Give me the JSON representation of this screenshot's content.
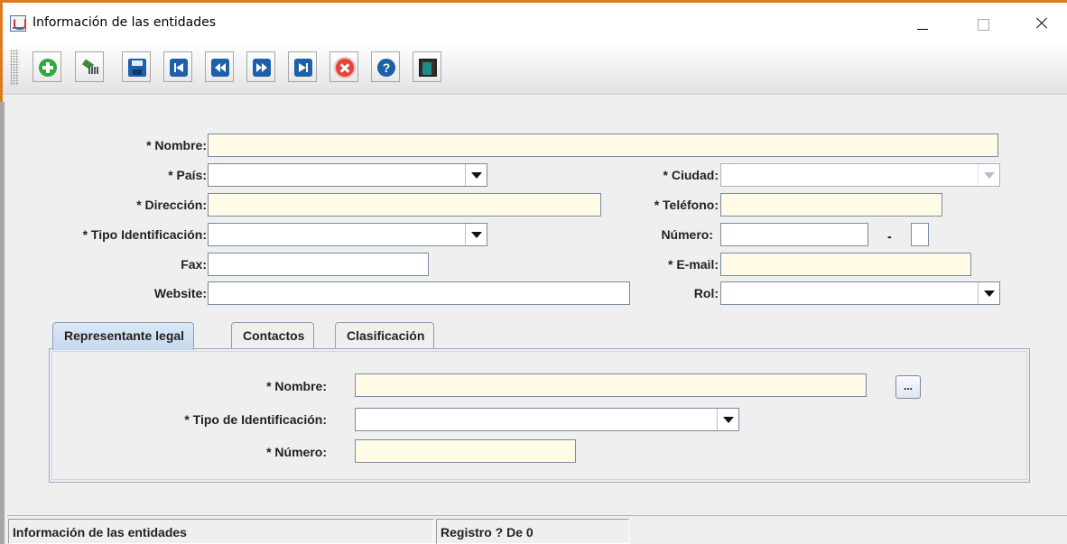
{
  "window": {
    "title": "Información de las entidades"
  },
  "toolbar": {
    "buttons": [
      {
        "name": "add-button",
        "icon": "plus-circle-icon"
      },
      {
        "name": "clear-button",
        "icon": "broom-icon"
      },
      {
        "name": "save-button",
        "icon": "floppy-disk-icon"
      },
      {
        "name": "first-record-button",
        "icon": "skip-first-icon"
      },
      {
        "name": "previous-record-button",
        "icon": "rewind-icon"
      },
      {
        "name": "next-record-button",
        "icon": "fast-forward-icon"
      },
      {
        "name": "last-record-button",
        "icon": "skip-last-icon"
      },
      {
        "name": "cancel-button",
        "icon": "close-circle-icon"
      },
      {
        "name": "help-button",
        "icon": "question-icon"
      },
      {
        "name": "exit-button",
        "icon": "exit-door-icon"
      }
    ]
  },
  "form": {
    "nombre_label": "* Nombre:",
    "nombre_value": "",
    "pais_label": "* País:",
    "pais_value": "",
    "ciudad_label": "* Ciudad:",
    "ciudad_value": "",
    "direccion_label": "* Dirección:",
    "direccion_value": "",
    "telefono_label": "* Teléfono:",
    "telefono_value": "",
    "tipo_id_label": "* Tipo Identificación:",
    "tipo_id_value": "",
    "numero_label": "Número:",
    "numero_value": "",
    "numero_separator": "-",
    "numero_dv_value": "",
    "fax_label": "Fax:",
    "fax_value": "",
    "email_label": "* E-mail:",
    "email_value": "",
    "website_label": "Website:",
    "website_value": "",
    "rol_label": "Rol:",
    "rol_value": ""
  },
  "tabs": [
    {
      "label": "Representante legal",
      "active": true
    },
    {
      "label": "Contactos",
      "active": false
    },
    {
      "label": "Clasificación",
      "active": false
    }
  ],
  "representante": {
    "nombre_label": "* Nombre:",
    "nombre_value": "",
    "browse_label": "...",
    "tipo_id_label": "* Tipo de Identificación:",
    "tipo_id_value": "",
    "numero_label": "* Número:",
    "numero_value": ""
  },
  "status": {
    "title": "Información de las entidades",
    "record": "Registro ? De 0"
  },
  "colors": {
    "required_field_bg": "#fffbe6",
    "window_accent": "#d97b1e",
    "active_tab": "#c6d9ee"
  }
}
